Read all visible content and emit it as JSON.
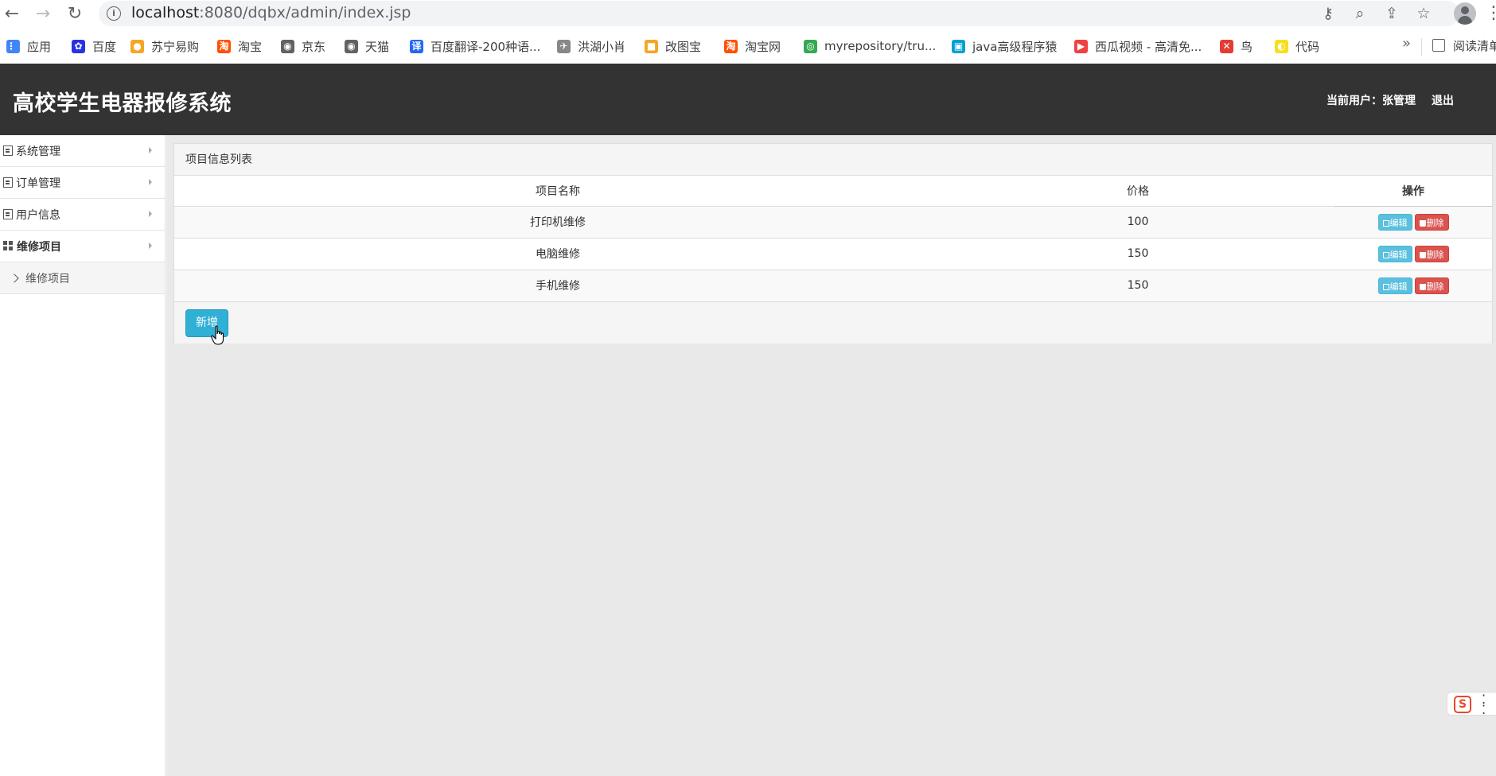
{
  "browser": {
    "url_host": "localhost",
    "url_rest": ":8080/dqbx/admin/index.jsp",
    "back_icon": "←",
    "forward_icon": "→",
    "reload_icon": "↻",
    "bookmarks": [
      {
        "label": "应用",
        "icon": "apps-icon",
        "color": "#4285f4"
      },
      {
        "label": "百度",
        "icon": "baidu-icon",
        "color": "#2932e1"
      },
      {
        "label": "苏宁易购",
        "icon": "suning-icon",
        "color": "#f5a623"
      },
      {
        "label": "淘宝",
        "icon": "taobao-icon",
        "color": "#ff5000"
      },
      {
        "label": "京东",
        "icon": "globe-icon",
        "color": "#5f6368"
      },
      {
        "label": "天猫",
        "icon": "globe-icon",
        "color": "#5f6368"
      },
      {
        "label": "百度翻译-200种语...",
        "icon": "fanyi-icon",
        "color": "#2468f2"
      },
      {
        "label": "洪湖小肖",
        "icon": "bird-icon",
        "color": "#888888"
      },
      {
        "label": "改图宝",
        "icon": "gaitubao-icon",
        "color": "#f5a623"
      },
      {
        "label": "淘宝网",
        "icon": "taobao-icon",
        "color": "#ff5000"
      },
      {
        "label": "myrepository/tru...",
        "icon": "chrome-icon",
        "color": "#34a853"
      },
      {
        "label": "java高级程序猿",
        "icon": "bilibili-icon",
        "color": "#00a1d6"
      },
      {
        "label": "西瓜视频 - 高清免...",
        "icon": "xigua-icon",
        "color": "#f04142"
      },
      {
        "label": "鸟",
        "icon": "bird-red-icon",
        "color": "#e33e33"
      },
      {
        "label": "代码",
        "icon": "code-icon",
        "color": "#f7df1e"
      }
    ],
    "more": "»",
    "reading_list": "阅读清单"
  },
  "app": {
    "title": "高校学生电器报修系统",
    "current_user_label": "当前用户：张管理",
    "logout": "退出"
  },
  "sidebar": {
    "items": [
      {
        "label": "系统管理"
      },
      {
        "label": "订单管理"
      },
      {
        "label": "用户信息"
      },
      {
        "label": "维修项目"
      }
    ],
    "sub_item": "维修项目"
  },
  "panel": {
    "heading": "项目信息列表",
    "columns": [
      "项目名称",
      "价格",
      "操作"
    ],
    "rows": [
      {
        "name": "打印机维修",
        "price": "100"
      },
      {
        "name": "电脑维修",
        "price": "150"
      },
      {
        "name": "手机维修",
        "price": "150"
      }
    ],
    "edit_label": "编辑",
    "delete_label": "删除",
    "add_label": "新增"
  },
  "ime": {
    "label": "S"
  }
}
